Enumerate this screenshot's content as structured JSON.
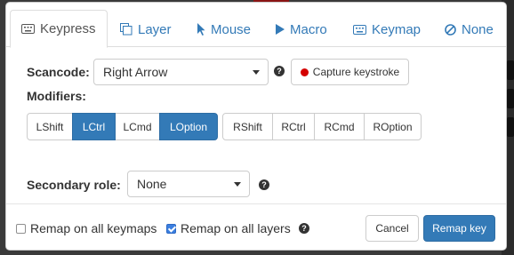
{
  "tabs": [
    {
      "label": "Keypress",
      "icon": "keyboard-icon",
      "active": true
    },
    {
      "label": "Layer",
      "icon": "layers-icon",
      "active": false
    },
    {
      "label": "Mouse",
      "icon": "mouse-pointer-icon",
      "active": false
    },
    {
      "label": "Macro",
      "icon": "play-icon",
      "active": false
    },
    {
      "label": "Keymap",
      "icon": "keyboard-icon",
      "active": false
    },
    {
      "label": "None",
      "icon": "ban-icon",
      "active": false
    }
  ],
  "scancode": {
    "label": "Scancode:",
    "value": "Right Arrow",
    "capture_label": "Capture keystroke"
  },
  "modifiers": {
    "label": "Modifiers:",
    "left": [
      {
        "label": "LShift",
        "active": false
      },
      {
        "label": "LCtrl",
        "active": true
      },
      {
        "label": "LCmd",
        "active": false
      },
      {
        "label": "LOption",
        "active": true
      }
    ],
    "right": [
      {
        "label": "RShift",
        "active": false
      },
      {
        "label": "RCtrl",
        "active": false
      },
      {
        "label": "RCmd",
        "active": false
      },
      {
        "label": "ROption",
        "active": false
      }
    ]
  },
  "secondary_role": {
    "label": "Secondary role:",
    "value": "None"
  },
  "footer": {
    "remap_all_keymaps": {
      "label": "Remap on all keymaps",
      "checked": false
    },
    "remap_all_layers": {
      "label": "Remap on all layers",
      "checked": true
    },
    "cancel_label": "Cancel",
    "remap_key_label": "Remap key"
  },
  "colors": {
    "accent": "#337ab7",
    "record_dot": "#d40000",
    "link": "#337ab7"
  }
}
